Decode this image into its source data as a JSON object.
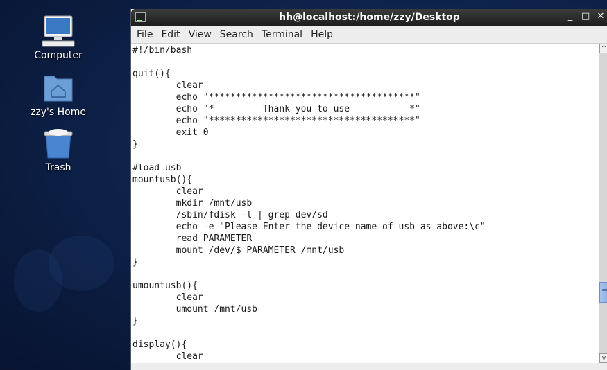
{
  "desktop": {
    "icons": [
      {
        "label": "Computer",
        "icon": "computer-icon"
      },
      {
        "label": "zzy's Home",
        "icon": "home-folder-icon"
      },
      {
        "label": "Trash",
        "icon": "trash-icon"
      }
    ]
  },
  "window": {
    "title": "hh@localhost:/home/zzy/Desktop",
    "controls": {
      "minimize": "_",
      "maximize": "□",
      "close": "✕"
    },
    "menu": [
      "File",
      "Edit",
      "View",
      "Search",
      "Terminal",
      "Help"
    ]
  },
  "terminal": {
    "lines": [
      "#!/bin/bash",
      "",
      "quit(){",
      "        clear",
      "        echo \"**************************************\"",
      "        echo \"*         Thank you to use           *\"",
      "        echo \"**************************************\"",
      "        exit 0",
      "}",
      "",
      "#load usb",
      "mountusb(){",
      "        clear",
      "        mkdir /mnt/usb",
      "        /sbin/fdisk -l | grep dev/sd",
      "        echo -e \"Please Enter the device name of usb as above:\\c\"",
      "        read PARAMETER",
      "        mount /dev/$ PARAMETER /mnt/usb",
      "}",
      "",
      "umountusb(){",
      "        clear",
      "        umount /mnt/usb",
      "}",
      "",
      "display(){",
      "        clear"
    ]
  },
  "scrollbar": {
    "up": "^",
    "down": "v",
    "position_fraction": 0.82
  }
}
